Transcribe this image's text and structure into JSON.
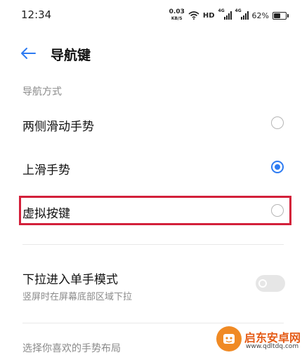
{
  "status_bar": {
    "time": "12:34",
    "speed_value": "0.03",
    "speed_unit": "KB/S",
    "hd": "HD",
    "sig1_tag": "4G",
    "sig2_tag": "4G",
    "battery_text": "62%",
    "battery_level": 0.62
  },
  "header": {
    "title": "导航键"
  },
  "nav_section": {
    "label": "导航方式",
    "options": [
      {
        "label": "两侧滑动手势",
        "selected": false
      },
      {
        "label": "上滑手势",
        "selected": true
      },
      {
        "label": "虚拟按键",
        "selected": false
      }
    ]
  },
  "one_hand": {
    "title": "下拉进入单手模式",
    "subtitle": "竖屏时在屏幕底部区域下拉",
    "enabled": false
  },
  "layout_section": {
    "label": "选择你喜欢的手势布局"
  },
  "watermark": {
    "name": "启东安卓网",
    "url": "www.qdltdq.com"
  },
  "colors": {
    "accent": "#2d7bf2",
    "highlight": "#d3203a",
    "watermark": "#e45b16"
  }
}
